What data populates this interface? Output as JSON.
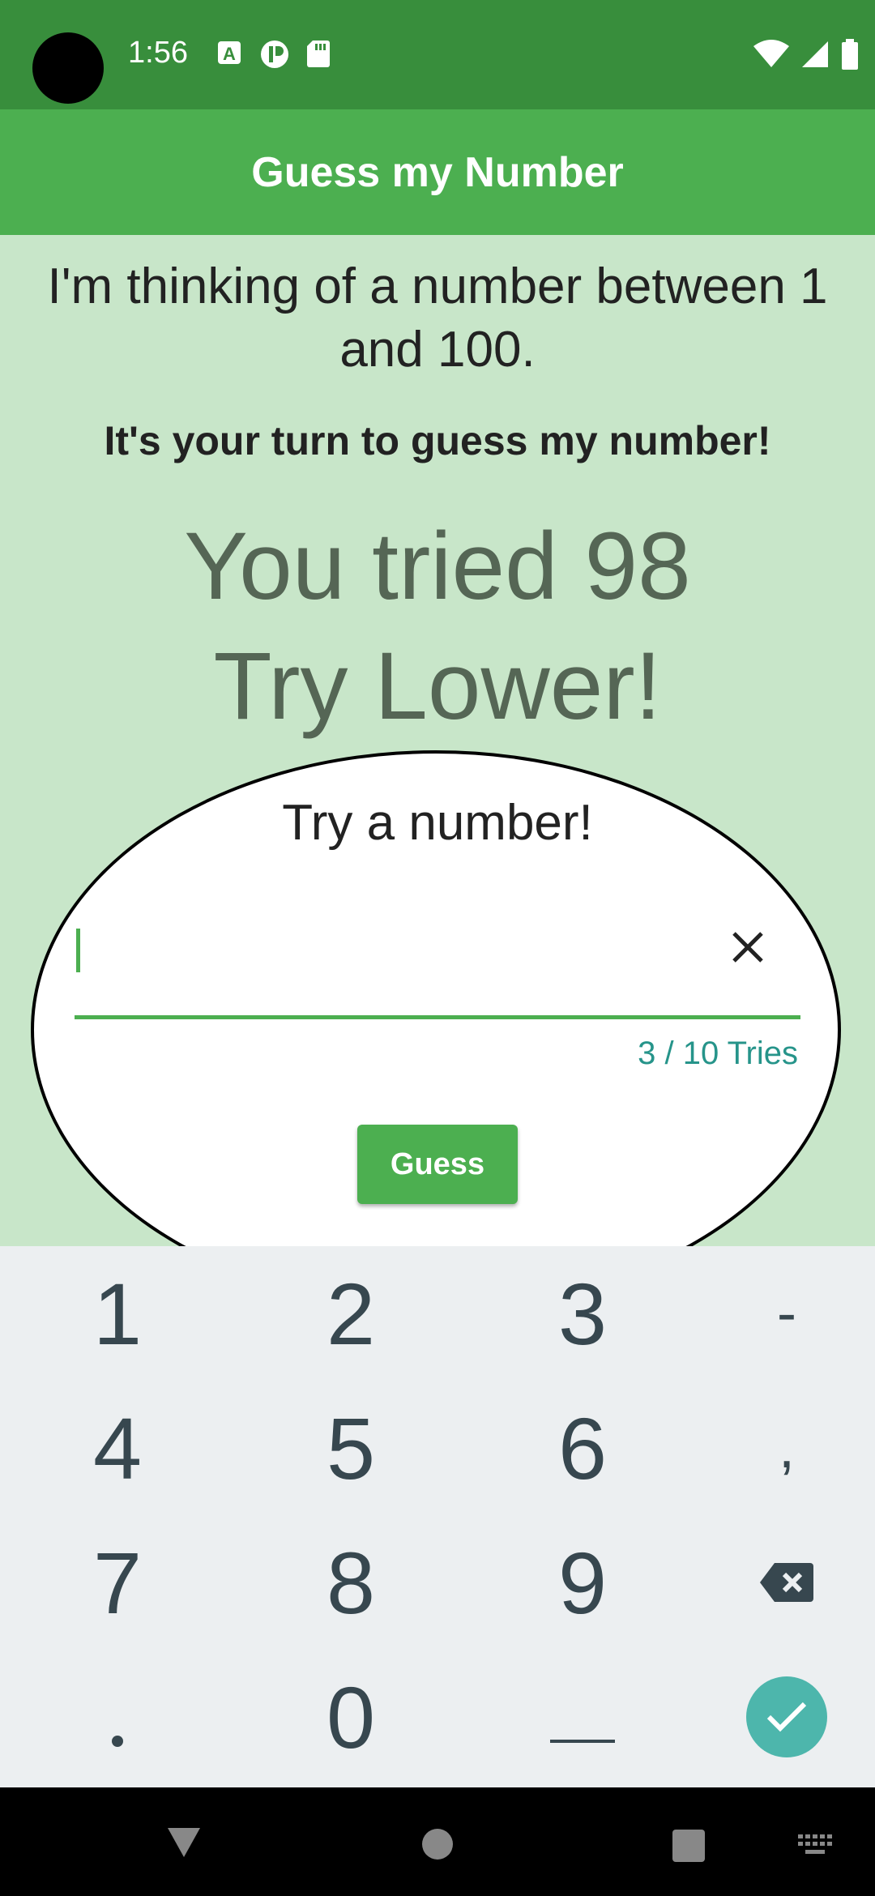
{
  "status_bar": {
    "time": "1:56",
    "icons": [
      "a-notification-icon",
      "chat-notification-icon",
      "sd-card-icon",
      "wifi-icon",
      "signal-icon",
      "battery-icon"
    ]
  },
  "app_bar": {
    "title": "Guess my Number"
  },
  "game": {
    "intro": "I'm thinking of a number between 1 and 100.",
    "turn_prompt": "It's your turn to guess my number!",
    "last_guess_text": "You tried 98",
    "hint_text": "Try Lower!"
  },
  "guess_dialog": {
    "title": "Try a number!",
    "input_value": "",
    "counter": "3 / 10 Tries",
    "button_label": "Guess"
  },
  "keyboard": {
    "row1": [
      "1",
      "2",
      "3",
      "-"
    ],
    "row2": [
      "4",
      "5",
      "6",
      ","
    ],
    "row3": [
      "7",
      "8",
      "9"
    ],
    "row4": [
      ".",
      "0"
    ],
    "icons": [
      "backspace-icon",
      "checkmark-icon",
      "space-icon"
    ]
  },
  "colors": {
    "status_bar": "#388e3c",
    "app_bar": "#4caf50",
    "background": "#c8e6c9",
    "counter": "#26948a",
    "keyboard": "#eceff1",
    "enter_key": "#4db6ac"
  }
}
